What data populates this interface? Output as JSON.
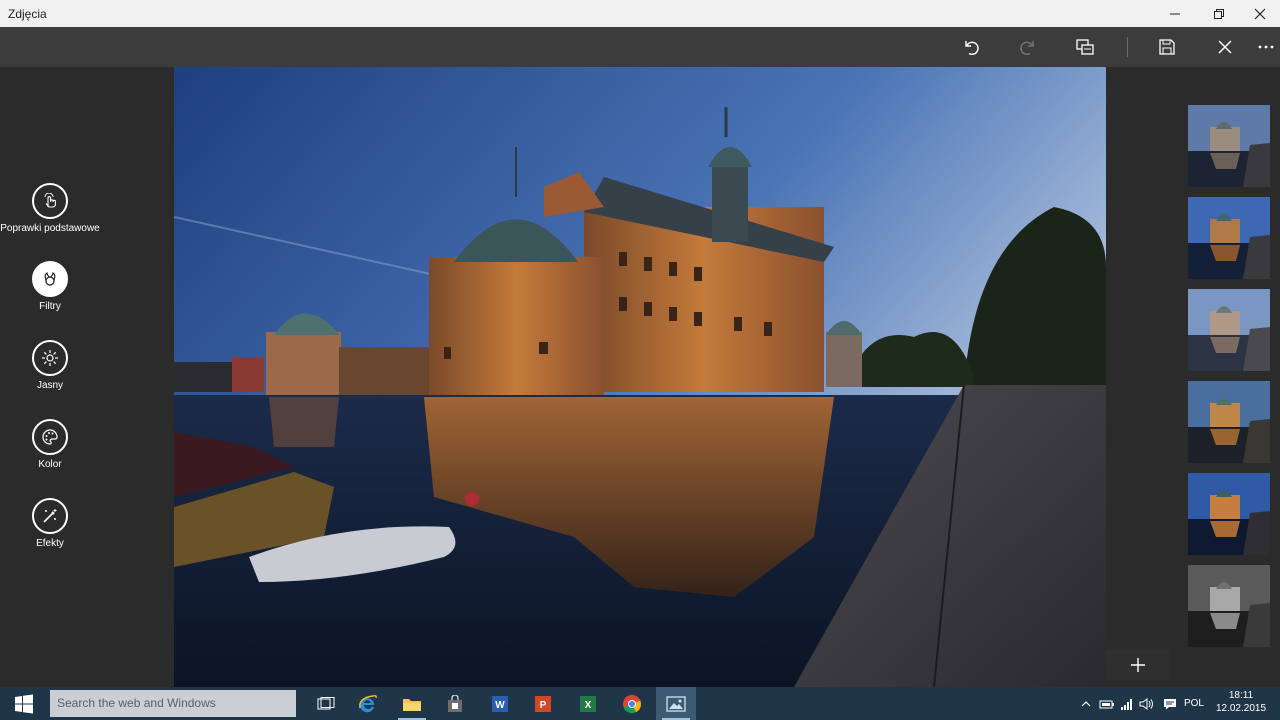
{
  "window": {
    "title": "Zdjęcia"
  },
  "toolbar": {
    "buttons": [
      {
        "name": "undo-button",
        "icon": "undo-icon"
      },
      {
        "name": "redo-button",
        "icon": "redo-icon",
        "disabled": true
      },
      {
        "name": "compare-button",
        "icon": "compare-icon"
      },
      {
        "name": "save-copy-button",
        "icon": "save-copy-icon"
      },
      {
        "name": "close-editor-button",
        "icon": "close-icon"
      },
      {
        "name": "more-button",
        "icon": "more-icon"
      }
    ]
  },
  "tools": [
    {
      "label": "Poprawki podstawowe",
      "icon": "touch-icon",
      "active": false
    },
    {
      "label": "Filtry",
      "icon": "filter-icon",
      "active": true
    },
    {
      "label": "Jasny",
      "icon": "sun-icon",
      "active": false
    },
    {
      "label": "Kolor",
      "icon": "palette-icon",
      "active": false
    },
    {
      "label": "Efekty",
      "icon": "effects-icon",
      "active": false
    }
  ],
  "filters": [
    {
      "name": "filter-1"
    },
    {
      "name": "filter-2"
    },
    {
      "name": "filter-3"
    },
    {
      "name": "filter-4"
    },
    {
      "name": "filter-5"
    },
    {
      "name": "filter-6-bw"
    }
  ],
  "taskbar": {
    "search_placeholder": "Search the web and Windows",
    "apps": [
      "task-view-icon",
      "edge-ie-icon",
      "file-explorer-icon",
      "store-icon",
      "word-icon",
      "powerpoint-icon",
      "excel-icon",
      "chrome-icon",
      "photos-icon"
    ],
    "language": "POL",
    "time": "18:11",
    "date": "12.02.2015"
  },
  "colors": {
    "accent": "#3e5a73",
    "taskbar": "#1f3548",
    "panel": "#2b2b2b",
    "cmdbar": "#3c3c3c"
  }
}
